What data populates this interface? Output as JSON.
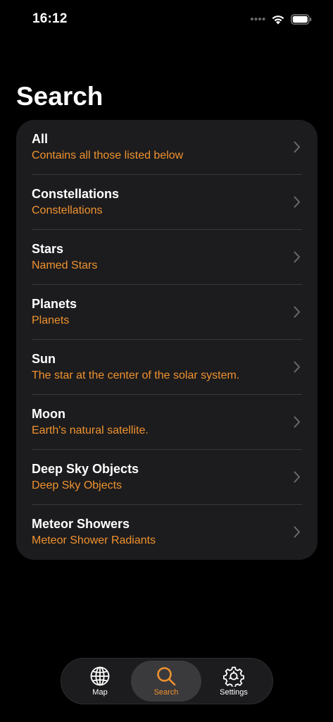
{
  "status_bar": {
    "time": "16:12"
  },
  "page": {
    "title": "Search"
  },
  "colors": {
    "accent": "#f0922e",
    "card_background": "#1c1c1e",
    "background": "#000000"
  },
  "list": {
    "items": [
      {
        "title": "All",
        "subtitle": "Contains all those listed below"
      },
      {
        "title": "Constellations",
        "subtitle": "Constellations"
      },
      {
        "title": "Stars",
        "subtitle": "Named Stars"
      },
      {
        "title": "Planets",
        "subtitle": "Planets"
      },
      {
        "title": "Sun",
        "subtitle": "The star at the center of the solar system."
      },
      {
        "title": "Moon",
        "subtitle": "Earth's natural satellite."
      },
      {
        "title": "Deep Sky Objects",
        "subtitle": "Deep Sky Objects"
      },
      {
        "title": "Meteor Showers",
        "subtitle": "Meteor Shower Radiants"
      }
    ]
  },
  "tab_bar": {
    "tabs": [
      {
        "label": "Map",
        "icon": "globe-icon",
        "active": false
      },
      {
        "label": "Search",
        "icon": "magnifying-glass-icon",
        "active": true
      },
      {
        "label": "Settings",
        "icon": "gear-icon",
        "active": false
      }
    ]
  }
}
